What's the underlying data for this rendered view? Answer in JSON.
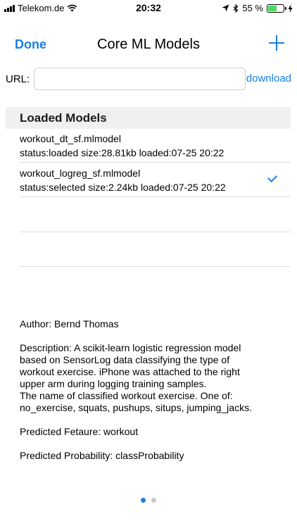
{
  "status_bar": {
    "carrier": "Telekom.de",
    "time": "20:32",
    "battery_percent": "55 %",
    "battery_level": 0.55
  },
  "nav": {
    "done_label": "Done",
    "title": "Core ML Models",
    "add_icon": "plus-icon"
  },
  "url_row": {
    "label": "URL:",
    "value": "",
    "placeholder": "",
    "download_label": "download"
  },
  "models": {
    "section_title": "Loaded Models",
    "items": [
      {
        "name": "workout_dt_sf.mlmodel",
        "info": "status:loaded  size:28.81kb  loaded:07-25 20:22",
        "selected": false
      },
      {
        "name": "workout_logreg_sf.mlmodel",
        "info": "status:selected  size:2.24kb  loaded:07-25 20:22",
        "selected": true
      }
    ]
  },
  "details": {
    "author": "Author: Bernd Thomas",
    "description_lines": [
      "Description: A scikit-learn logistic regression model",
      "based on SensorLog data classifying the type of",
      "workout exercise. iPhone was attached to the right",
      "upper arm during logging training samples.",
      "The name of classified workout exercise. One of:",
      "no_exercise, squats, pushups, situps, jumping_jacks."
    ],
    "predicted_feature": "Predicted Fetaure: workout",
    "predicted_probability": "Predicted Probability: classProbability"
  },
  "pager": {
    "count": 2,
    "active": 0
  },
  "colors": {
    "accent": "#1a7ee6",
    "battery": "#4cd964"
  }
}
